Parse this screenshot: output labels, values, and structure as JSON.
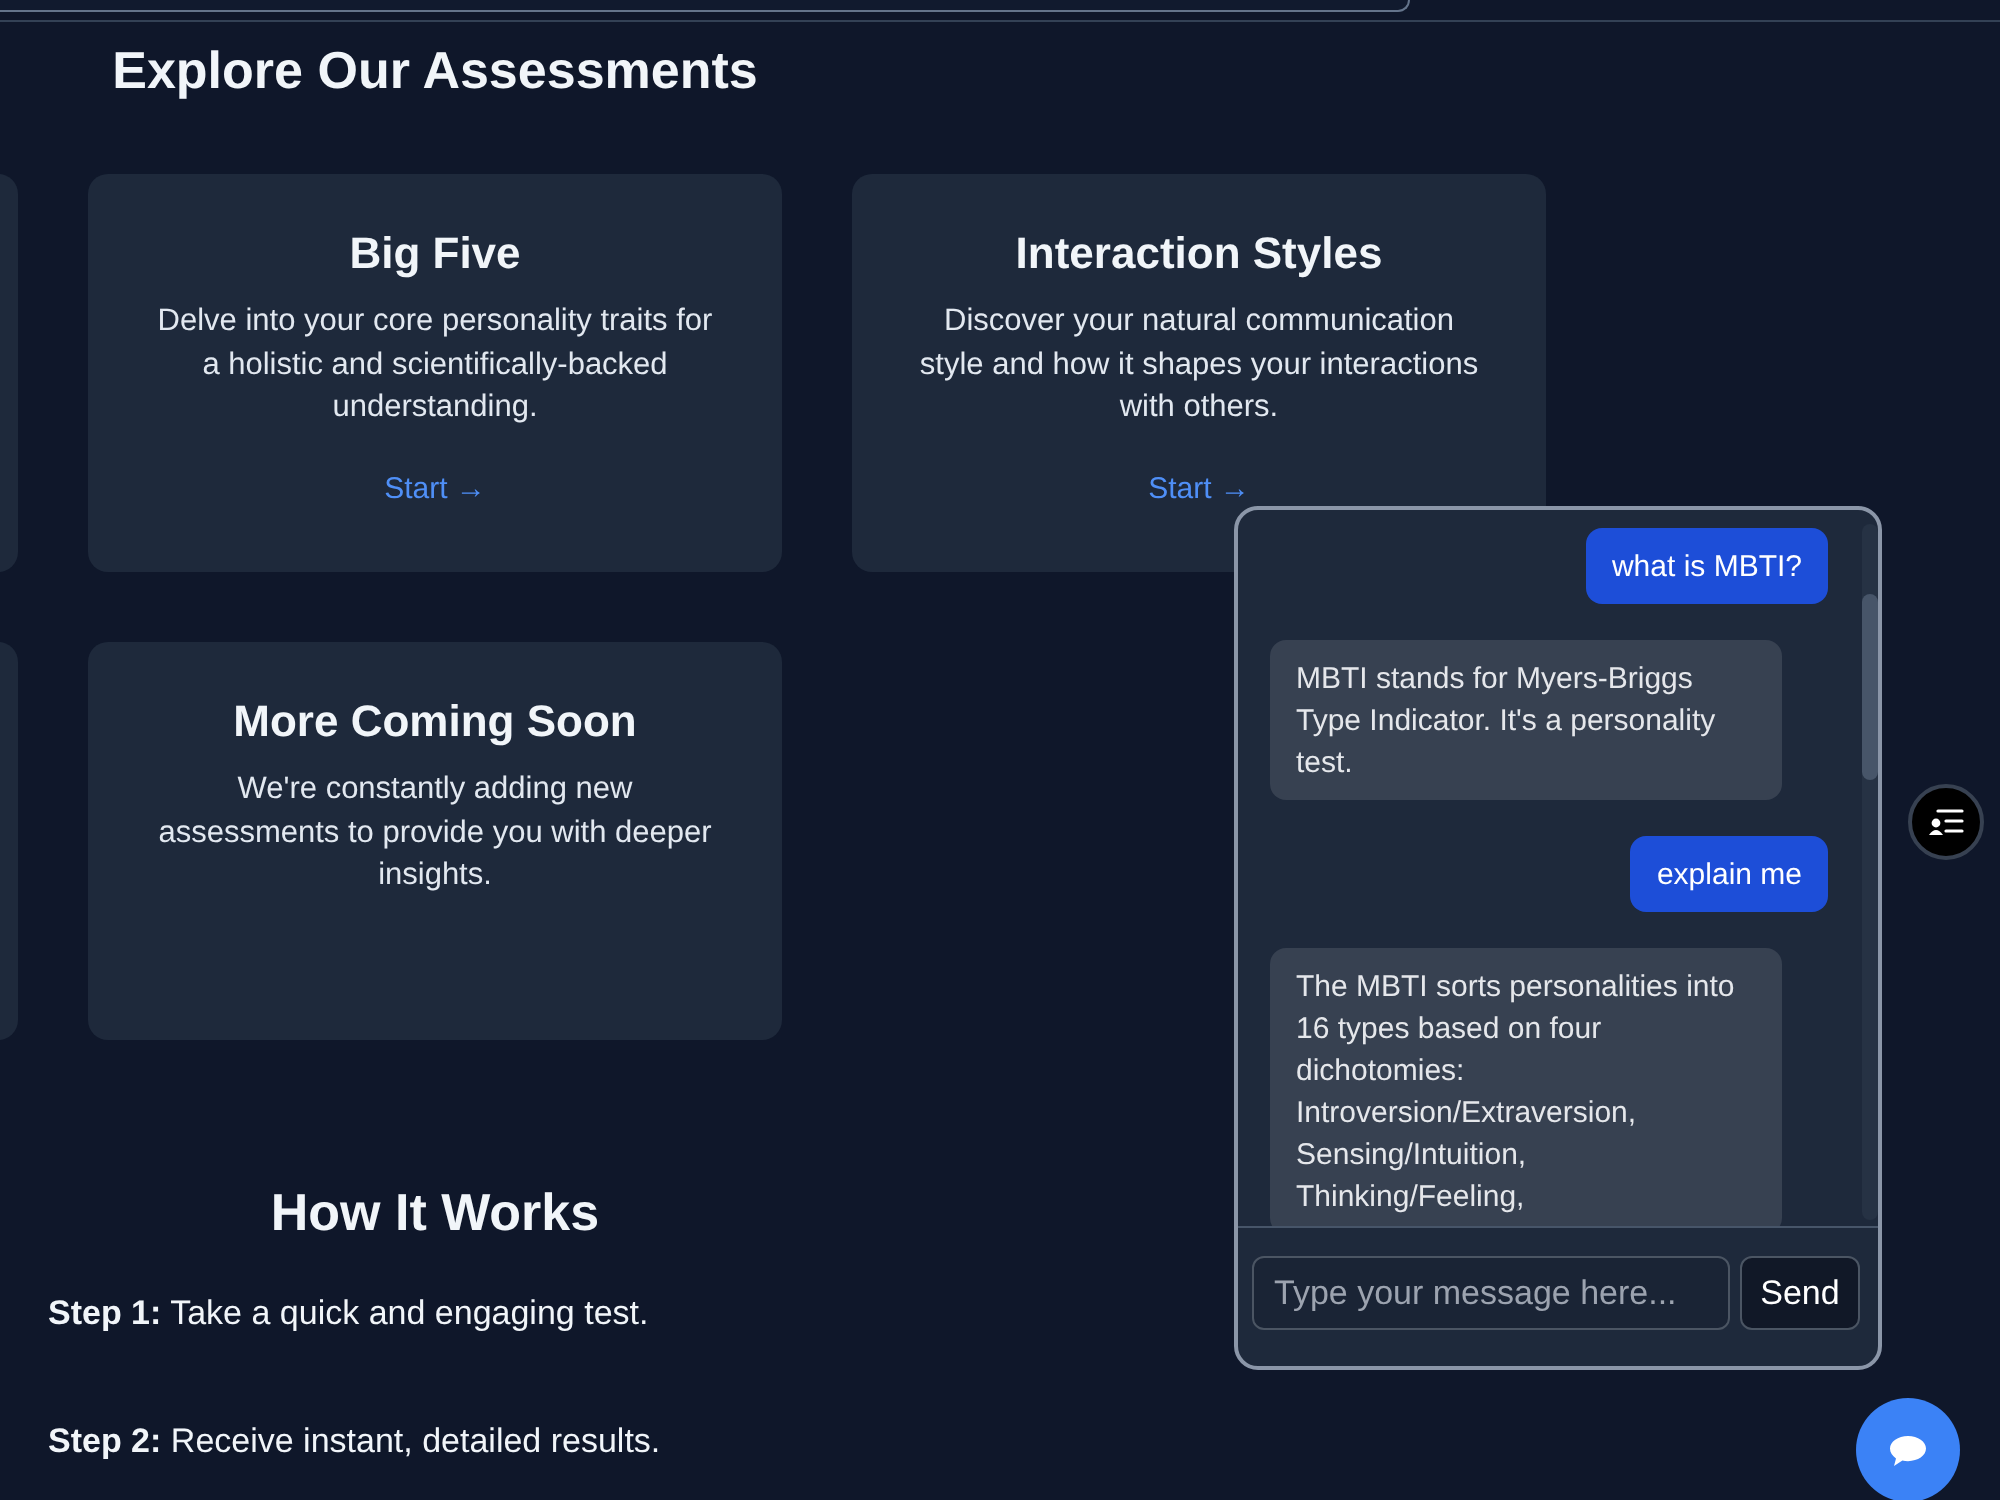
{
  "page": {
    "title": "Explore Our Assessments"
  },
  "assessments": [
    {
      "title": "Big Five",
      "description": "Delve into your core personality traits for a holistic and scientifically-backed understanding.",
      "link": "Start →"
    },
    {
      "title": "Interaction Styles",
      "description": "Discover your natural communication style and how it shapes your interactions with others.",
      "link": "Start →"
    },
    {
      "title": "More Coming Soon",
      "description": "We're constantly adding new assessments to provide you with deeper insights."
    }
  ],
  "how_it_works": {
    "title": "How It Works",
    "steps": [
      "**Step 1:** Take a quick and engaging test.",
      "**Step 2:** Receive instant, detailed results."
    ]
  },
  "chat": {
    "messages": [
      {
        "kind": "user",
        "text": "what is MBTI?"
      },
      {
        "kind": "assistant",
        "text": "MBTI stands for Myers-Briggs Type Indicator. It's a personality test."
      },
      {
        "kind": "user",
        "text": "explain me"
      },
      {
        "kind": "assistant",
        "text": "The MBTI sorts personalities into 16 types based on four dichotomies: Introversion/Extraversion, Sensing/Intuition, Thinking/Feeling,"
      }
    ],
    "input": {
      "placeholder": "Type your message here..."
    },
    "send_button": "Send"
  }
}
